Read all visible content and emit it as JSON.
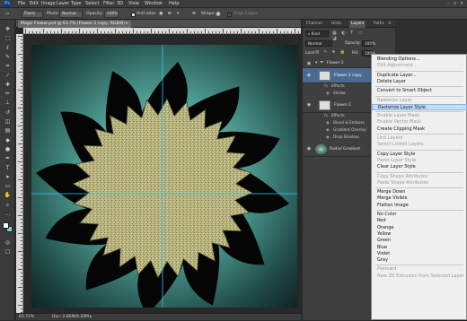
{
  "app": {
    "logo": "Ps"
  },
  "menu": [
    "File",
    "Edit",
    "Image",
    "Layer",
    "Type",
    "Select",
    "Filter",
    "3D",
    "View",
    "Window",
    "Help"
  ],
  "options": {
    "mode_label": "Mode:",
    "mode_value": "Normal",
    "opacity_label": "Opacity:",
    "opacity_value": "100%",
    "antialias_label": "Anti-alias",
    "shape_label": "Shape:",
    "align_label": "Align Edges",
    "preset_value": "Pixels"
  },
  "document": {
    "tab_title": "Magic Flower.psd @ 63.7% (Flower 2  copy, RGB/8)",
    "zoom": "63.72%",
    "doc_info": "Doc: 2.86M/8.29M"
  },
  "panels": {
    "tabs": [
      "Channel",
      "Histo",
      "Layers",
      "Paths"
    ],
    "active_tab": "Layers",
    "kind_label": "Kind",
    "blend_mode": "Normal",
    "opacity_label": "Opacity:",
    "opacity_value": "100%",
    "lock_label": "Lock:",
    "fill_label": "Fill:",
    "fill_value": "100%",
    "layers": [
      {
        "name": "Flower 2",
        "type": "group"
      },
      {
        "name": "Flower 2  copy",
        "type": "layer",
        "selected": true
      },
      {
        "name": "Effects",
        "type": "effect"
      },
      {
        "name": "Stroke",
        "type": "effect"
      },
      {
        "name": "Flower 2",
        "type": "layer"
      },
      {
        "name": "Effects",
        "type": "effect"
      },
      {
        "name": "Bevel & Emboss",
        "type": "effect"
      },
      {
        "name": "Gradient Overlay",
        "type": "effect"
      },
      {
        "name": "Drop Shadow",
        "type": "effect"
      },
      {
        "name": "Radial Gradient",
        "type": "layer"
      }
    ]
  },
  "context_menu": {
    "groups": [
      [
        {
          "label": "Blending Options...",
          "enabled": true
        },
        {
          "label": "Edit Adjustment...",
          "enabled": false
        }
      ],
      [
        {
          "label": "Duplicate Layer...",
          "enabled": true
        },
        {
          "label": "Delete Layer",
          "enabled": true
        }
      ],
      [
        {
          "label": "Convert to Smart Object",
          "enabled": true
        }
      ],
      [
        {
          "label": "Rasterize Layer",
          "enabled": false
        },
        {
          "label": "Rasterize Layer Style",
          "enabled": true,
          "highlighted": true
        }
      ],
      [
        {
          "label": "Enable Layer Mask",
          "enabled": false
        },
        {
          "label": "Enable Vector Mask",
          "enabled": false
        },
        {
          "label": "Create Clipping Mask",
          "enabled": true
        }
      ],
      [
        {
          "label": "Link Layers",
          "enabled": false
        },
        {
          "label": "Select Linked Layers",
          "enabled": false
        }
      ],
      [
        {
          "label": "Copy Layer Style",
          "enabled": true
        },
        {
          "label": "Paste Layer Style",
          "enabled": false
        },
        {
          "label": "Clear Layer Style",
          "enabled": true
        }
      ],
      [
        {
          "label": "Copy Shape Attributes",
          "enabled": false
        },
        {
          "label": "Paste Shape Attributes",
          "enabled": false
        }
      ],
      [
        {
          "label": "Merge Down",
          "enabled": true
        },
        {
          "label": "Merge Visible",
          "enabled": true
        },
        {
          "label": "Flatten Image",
          "enabled": true
        }
      ],
      [
        {
          "label": "No Color",
          "enabled": true
        },
        {
          "label": "Red",
          "enabled": true
        },
        {
          "label": "Orange",
          "enabled": true
        },
        {
          "label": "Yellow",
          "enabled": true
        },
        {
          "label": "Green",
          "enabled": true
        },
        {
          "label": "Blue",
          "enabled": true
        },
        {
          "label": "Violet",
          "enabled": true
        },
        {
          "label": "Gray",
          "enabled": true
        }
      ],
      [
        {
          "label": "Postcard",
          "enabled": false
        },
        {
          "label": "New 3D Extrusion from Selected Layer",
          "enabled": false
        }
      ]
    ]
  },
  "colors": {
    "accent": "#45a4ff",
    "menu_highlight": "#c4dcf6",
    "canvas_center": "#7fd6c8",
    "flower_fill": "#c8c27a",
    "guide": "#2ec8ff"
  }
}
